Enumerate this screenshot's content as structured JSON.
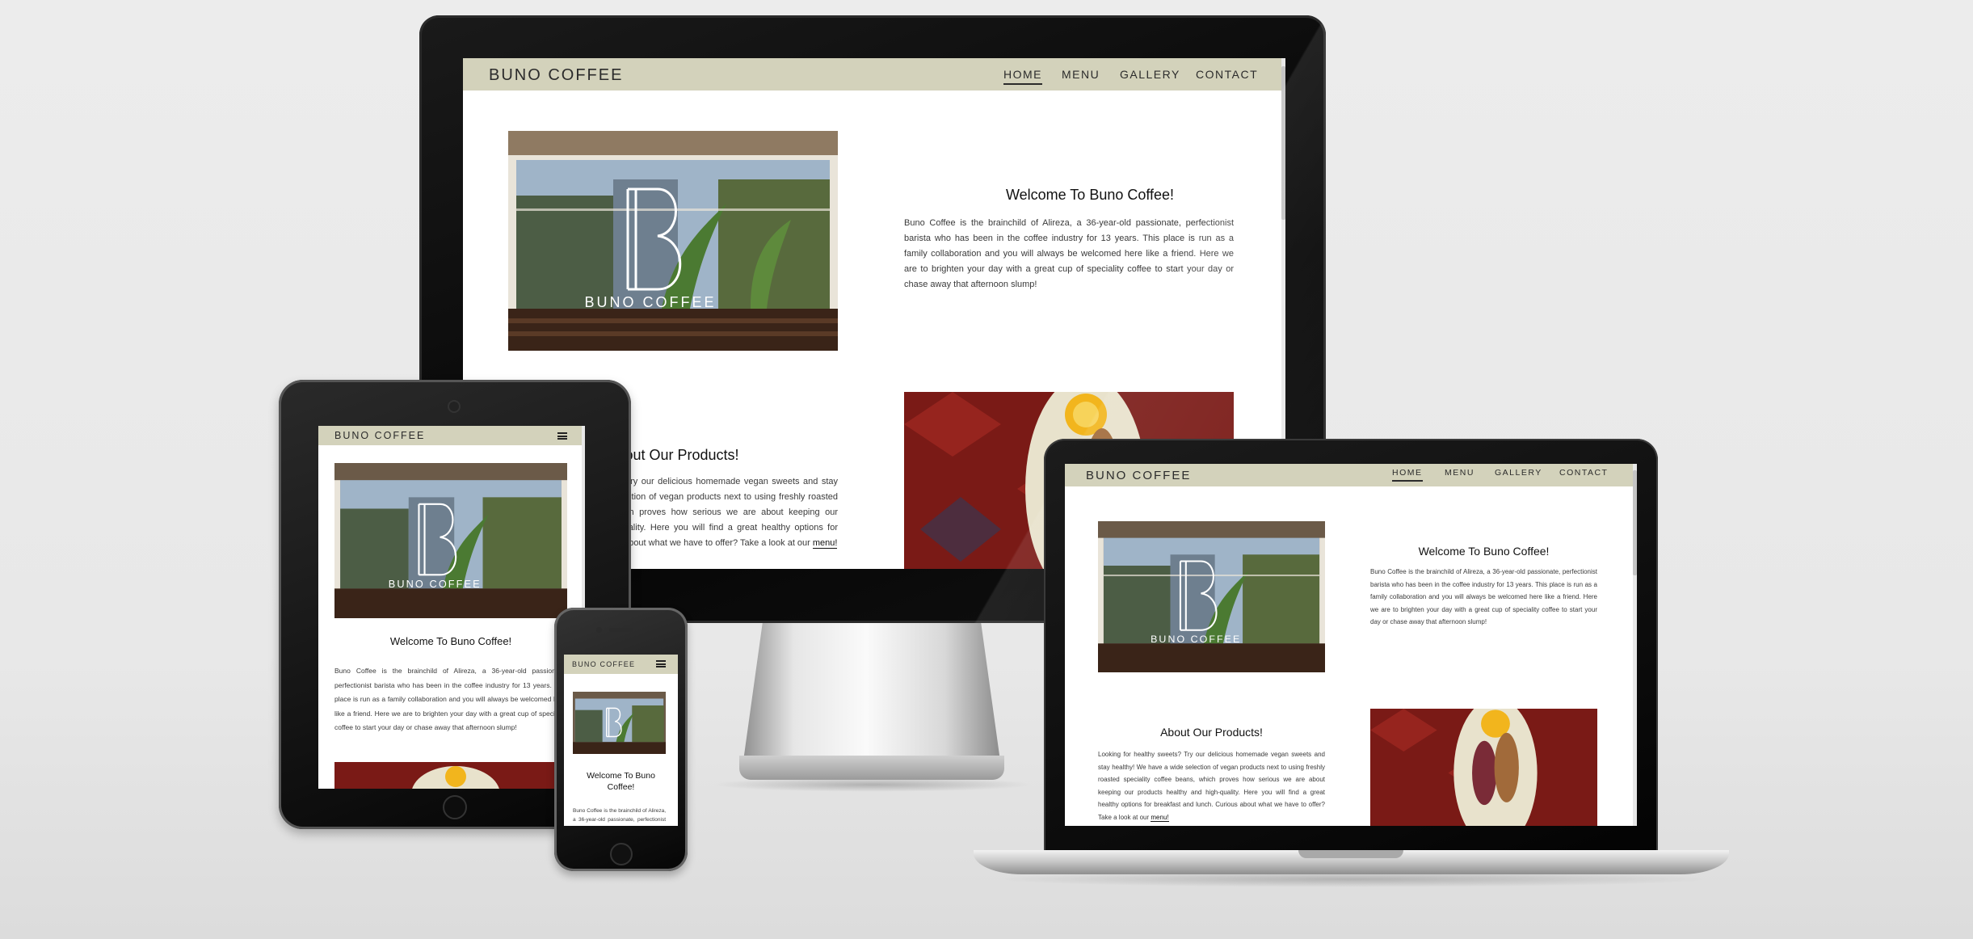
{
  "site": {
    "brand": "BUNO COFFEE",
    "nav": [
      {
        "label": "HOME",
        "active": true
      },
      {
        "label": "MENU",
        "active": false
      },
      {
        "label": "GALLERY",
        "active": false
      },
      {
        "label": "CONTACT",
        "active": false
      }
    ],
    "logo_text": "BUNO COFFEE",
    "logo_letter": "B",
    "welcome": {
      "title": "Welcome To Buno Coffee!",
      "title_wrapped": [
        "Welcome To Buno",
        "Coffee!"
      ],
      "body": "Buno Coffee is the brainchild of Alireza, a 36-year-old passionate, perfectionist barista who has been in the coffee industry for 13 years. This place is run as a family collaboration and you will always be welcomed here like a friend. Here we are to brighten your day with a great cup of speciality coffee to start your day or chase away that afternoon slump!"
    },
    "products": {
      "title": "About Our Products!",
      "body": "Looking for healthy sweets? Try our delicious homemade vegan sweets and stay healthy! We have a wide selection of vegan products next to using freshly roasted speciality coffee beans, which proves how serious we are about keeping our products healthy and high-quality. Here you will find a great healthy options for breakfast and lunch. Curious about what we have to offer? Take a look at our",
      "link": "menu!"
    }
  },
  "colors": {
    "navbar": "#d3d2bb",
    "text": "#2b2b2b",
    "page_background": "#ececec"
  }
}
